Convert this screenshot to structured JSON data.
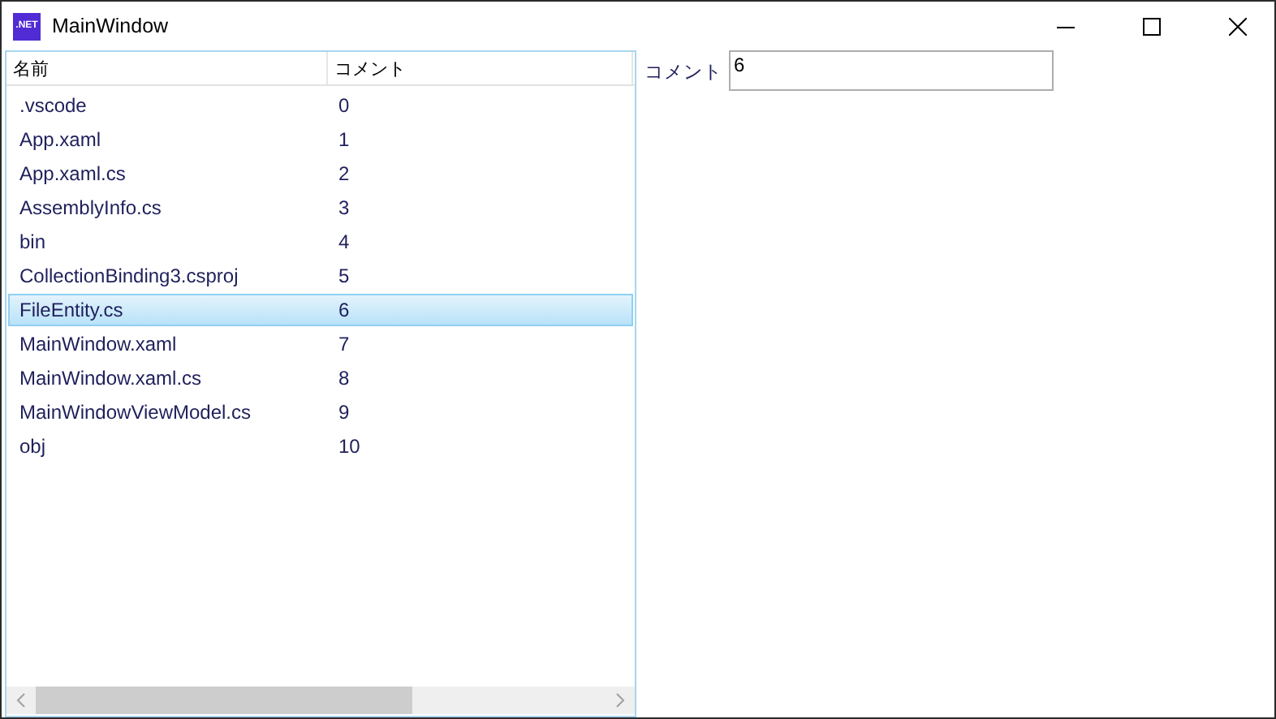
{
  "window": {
    "title": "MainWindow",
    "app_badge": ".NET"
  },
  "list": {
    "columns": [
      "名前",
      "コメント"
    ],
    "rows": [
      {
        "name": ".vscode",
        "comment": "0",
        "selected": false
      },
      {
        "name": "App.xaml",
        "comment": "1",
        "selected": false
      },
      {
        "name": "App.xaml.cs",
        "comment": "2",
        "selected": false
      },
      {
        "name": "AssemblyInfo.cs",
        "comment": "3",
        "selected": false
      },
      {
        "name": "bin",
        "comment": "4",
        "selected": false
      },
      {
        "name": "CollectionBinding3.csproj",
        "comment": "5",
        "selected": false
      },
      {
        "name": "FileEntity.cs",
        "comment": "6",
        "selected": true
      },
      {
        "name": "MainWindow.xaml",
        "comment": "7",
        "selected": false
      },
      {
        "name": "MainWindow.xaml.cs",
        "comment": "8",
        "selected": false
      },
      {
        "name": "MainWindowViewModel.cs",
        "comment": "9",
        "selected": false
      },
      {
        "name": "obj",
        "comment": "10",
        "selected": false
      }
    ]
  },
  "detail": {
    "label": "コメント",
    "value": "6"
  }
}
